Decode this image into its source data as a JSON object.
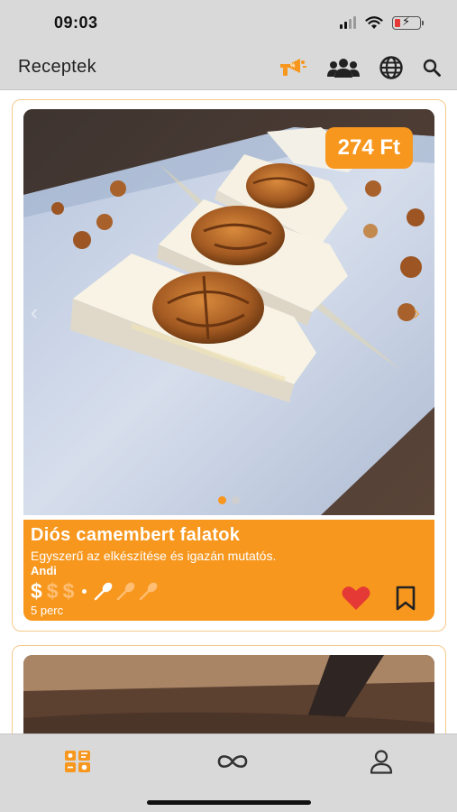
{
  "status_bar": {
    "time": "09:03"
  },
  "header": {
    "title": "Receptek",
    "icons": [
      "promo-megaphone-icon",
      "community-icon",
      "globe-icon",
      "search-icon"
    ]
  },
  "feed": {
    "cards": [
      {
        "price": "274 Ft",
        "title": "Diós camembert falatok",
        "description": "Egyszerű az elkészítése és igazán mutatós.",
        "author": "Andi",
        "cost_symbol": "$",
        "cost_level": 1,
        "cost_max": 3,
        "difficulty_level": 1,
        "difficulty_max": 3,
        "time": "5 perc",
        "liked": true,
        "saved": false,
        "carousel_images": 2,
        "carousel_active": 1
      }
    ]
  },
  "tab_bar": {
    "tabs": [
      "recipes-tab-icon",
      "infinity-icon",
      "profile-icon"
    ],
    "active": "recipes-tab-icon"
  },
  "colors": {
    "accent": "#f7971e",
    "bar_background": "#d9d9d9",
    "like_red": "#e53935"
  }
}
